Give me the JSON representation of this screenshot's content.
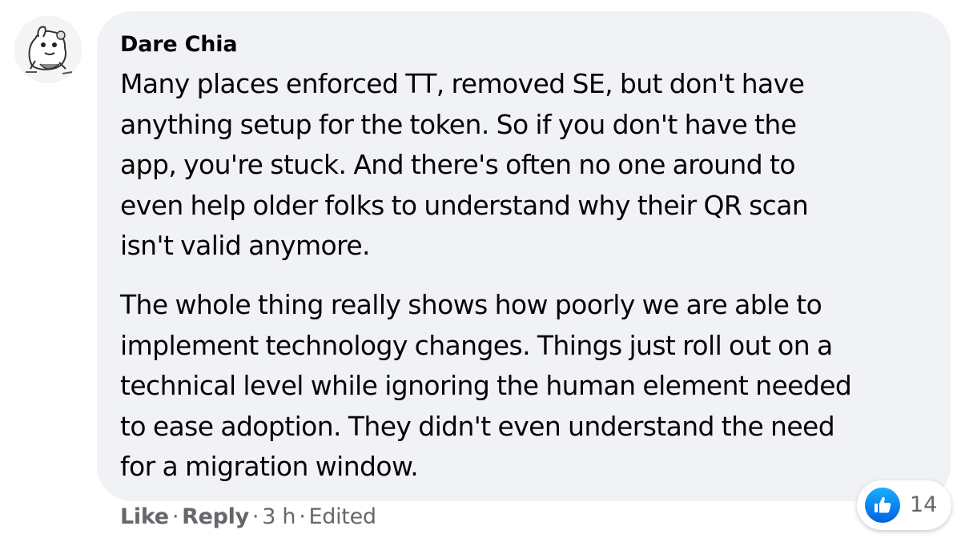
{
  "comment": {
    "author": "Dare Chia",
    "paragraphs": [
      [
        "Many places enforced TT, removed SE, but don't have",
        "anything setup for the token. So if you don't have the",
        "app, you're stuck. And there's often no one around to",
        "even help older folks to understand why their QR scan",
        "isn't valid anymore."
      ],
      [
        "The whole thing really shows how poorly we are able to",
        "implement technology changes. Things just roll out on a",
        "technical level while ignoring the human element needed",
        "to ease adoption. They didn't even understand the need",
        "for a migration window."
      ]
    ],
    "actions": {
      "like": "Like",
      "reply": "Reply",
      "time": "3 h",
      "edited": "Edited",
      "separator": "·"
    },
    "reactions": {
      "icon": "like-thumbs-up-icon",
      "count": "14",
      "color": "#1877f2"
    }
  }
}
